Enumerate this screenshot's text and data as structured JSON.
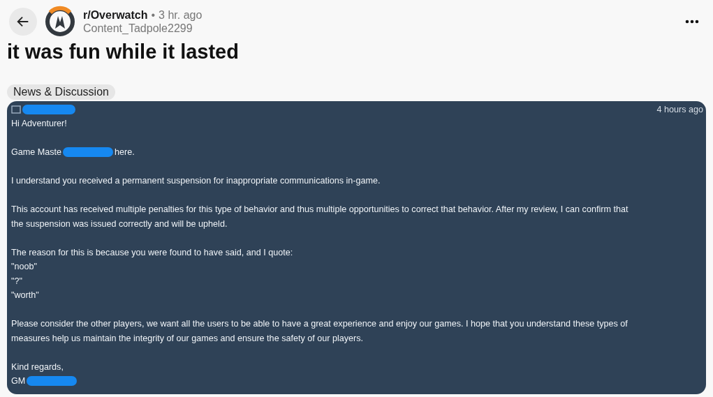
{
  "post": {
    "subreddit": "r/Overwatch",
    "separator": "•",
    "time": "3 hr. ago",
    "author": "Content_Tadpole2299",
    "title": "it was fun while it lasted",
    "flair": "News & Discussion"
  },
  "message": {
    "timestamp": "4 hours ago",
    "paragraphs": [
      [
        [
          {
            "kind": "text",
            "text": "Hi Adventurer!"
          }
        ]
      ],
      [
        [
          {
            "kind": "text",
            "text": "Game Maste"
          },
          {
            "kind": "redaction"
          },
          {
            "kind": "text",
            "text": "here."
          }
        ]
      ],
      [
        [
          {
            "kind": "text",
            "text": "I understand you received a permanent suspension for inappropriate communications in-game."
          }
        ]
      ],
      [
        [
          {
            "kind": "text",
            "text": "This account has received multiple penalties for this type of behavior and thus multiple opportunities to correct that behavior. After my review, I can confirm that"
          }
        ],
        [
          {
            "kind": "text",
            "text": "the suspension was issued correctly and will be upheld."
          }
        ]
      ],
      [
        [
          {
            "kind": "text",
            "text": "The reason for this is because you were found to have said, and I quote:"
          }
        ],
        [
          {
            "kind": "text",
            "text": "\"noob\""
          }
        ],
        [
          {
            "kind": "text",
            "text": "\"?\""
          }
        ],
        [
          {
            "kind": "text",
            "text": "\"worth\""
          }
        ]
      ],
      [
        [
          {
            "kind": "text",
            "text": "Please consider the other players, we want all the users to be able to have a great experience and enjoy our games. I hope that you understand these types of"
          }
        ],
        [
          {
            "kind": "text",
            "text": "measures help us maintain the integrity of our games and ensure the safety of our players."
          }
        ]
      ],
      [
        [
          {
            "kind": "text",
            "text": "Kind regards,"
          }
        ],
        [
          {
            "kind": "text",
            "text": "GM"
          },
          {
            "kind": "redaction"
          }
        ]
      ]
    ]
  }
}
